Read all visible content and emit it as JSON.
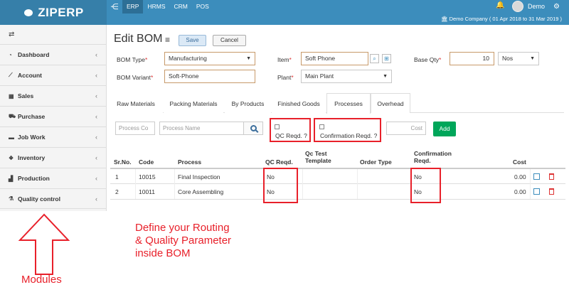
{
  "brand": {
    "name": "ZIPERP"
  },
  "topnav": {
    "tabs": [
      "ERP",
      "HRMS",
      "CRM",
      "POS"
    ],
    "active": "ERP"
  },
  "user": {
    "name": "Demo"
  },
  "company": {
    "text": "Demo Company ( 01 Apr 2018 to 31 Mar 2019 )"
  },
  "sidebar": {
    "items": [
      {
        "label": "Dashboard",
        "icon": "dashboard-icon"
      },
      {
        "label": "Account",
        "icon": "chart-icon"
      },
      {
        "label": "Sales",
        "icon": "calculator-icon"
      },
      {
        "label": "Purchase",
        "icon": "cart-icon"
      },
      {
        "label": "Job Work",
        "icon": "briefcase-icon"
      },
      {
        "label": "Inventory",
        "icon": "cubes-icon"
      },
      {
        "label": "Production",
        "icon": "industry-icon"
      },
      {
        "label": "Quality control",
        "icon": "flask-icon"
      }
    ]
  },
  "page": {
    "title": "Edit BOM",
    "save": "Save",
    "cancel": "Cancel"
  },
  "form": {
    "bom_type_label": "BOM Type",
    "bom_type_value": "Manufacturing",
    "item_label": "Item",
    "item_value": "Soft Phone",
    "base_qty_label": "Base Qty",
    "base_qty_value": "10",
    "unit_value": "Nos",
    "bom_variant_label": "BOM Variant",
    "bom_variant_value": "Soft-Phone",
    "plant_label": "Plant",
    "plant_value": "Main Plant",
    "required_mark": "*"
  },
  "tabs": [
    "Raw Materials",
    "Packing Materials",
    "By Products",
    "Finished Goods",
    "Processes",
    "Overhead"
  ],
  "active_tab": "Processes",
  "process_form": {
    "code_placeholder": "Process Co",
    "name_placeholder": "Process Name",
    "qc_label": "QC Reqd. ?",
    "confirm_label": "Confirmation Reqd. ?",
    "cost_placeholder": "Cost",
    "add": "Add"
  },
  "table": {
    "headers": {
      "srno": "Sr.No.",
      "code": "Code",
      "process": "Process",
      "qc": "QC Reqd.",
      "qc_test_1": "Qc Test",
      "qc_test_2": "Template",
      "order_type": "Order Type",
      "confirm_1": "Confirmation",
      "confirm_2": "Reqd.",
      "cost": "Cost"
    },
    "rows": [
      {
        "srno": "1",
        "code": "10015",
        "process": "Final Inspection",
        "qc": "No",
        "confirm": "No",
        "cost": "0.00"
      },
      {
        "srno": "2",
        "code": "10011",
        "process": "Core Assembling",
        "qc": "No",
        "confirm": "No",
        "cost": "0.00"
      }
    ]
  },
  "annotations": {
    "line1": "Define your Routing",
    "line2": "& Quality Parameter",
    "line3": "inside BOM",
    "modules": "Modules"
  },
  "colors": {
    "primary": "#3c8dbc",
    "highlight": "#e8202a",
    "add": "#00a65a"
  }
}
